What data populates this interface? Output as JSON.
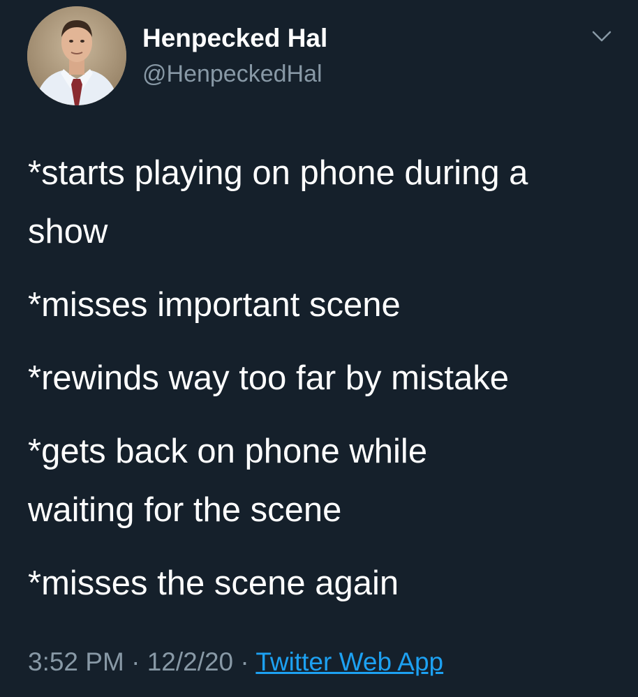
{
  "tweet": {
    "author": {
      "name": "Henpecked Hal",
      "handle": "@HenpeckedHal",
      "avatar_icon": "user-avatar-photo"
    },
    "menu_icon": "chevron-down-icon",
    "body_lines": [
      "*starts playing on phone during a",
      "show",
      "*misses important scene",
      "*rewinds way too far by mistake",
      "*gets back on phone while",
      "waiting for the scene",
      "*misses the scene again"
    ],
    "time": "3:52 PM",
    "date": "12/2/20",
    "separator": "·",
    "source": "Twitter Web App"
  },
  "colors": {
    "background": "#15202b",
    "text": "#ffffff",
    "secondary": "#8899a6",
    "link": "#1da1f2"
  }
}
